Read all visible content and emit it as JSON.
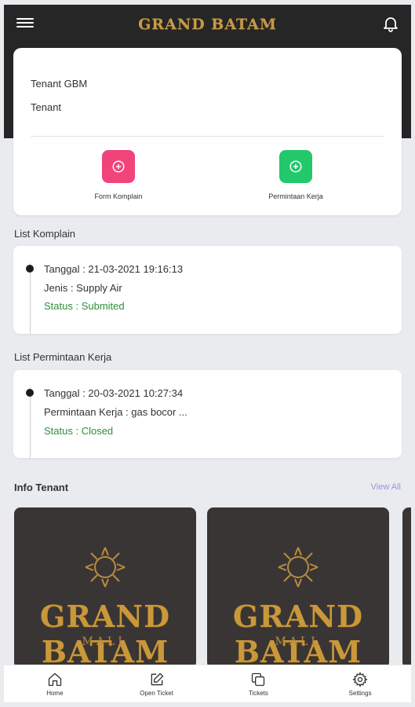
{
  "header": {
    "logo_text": "GRAND BATAM",
    "menu_icon": "hamburger-menu-icon",
    "bell_icon": "bell-icon"
  },
  "profile": {
    "tenant_name": "Tenant GBM",
    "role": "Tenant",
    "actions": [
      {
        "label": "Form Komplain",
        "icon": "plus-circle-icon",
        "color": "#f0447a"
      },
      {
        "label": "Permintaan Kerja",
        "icon": "plus-circle-icon",
        "color": "#22c86a"
      }
    ]
  },
  "komplain": {
    "section_title": "List Komplain",
    "item": {
      "tanggal": "Tanggal : 21-03-2021 19:16:13",
      "jenis": "Jenis : Supply Air",
      "status": "Status : Submited"
    }
  },
  "permintaan": {
    "section_title": "List Permintaan Kerja",
    "item": {
      "tanggal": "Tanggal : 20-03-2021 10:27:34",
      "detail": "Permintaan Kerja : gas bocor ...",
      "status": "Status : Closed"
    }
  },
  "info_tenant": {
    "section_title": "Info Tenant",
    "view_all": "View All",
    "cards": [
      {
        "brand": "GRAND BATAM",
        "sub": "MALL"
      },
      {
        "brand": "GRAND BATAM",
        "sub": "MALL"
      }
    ]
  },
  "bottom_nav": [
    {
      "label": "Home",
      "icon": "home-icon"
    },
    {
      "label": "Open Ticket",
      "icon": "edit-icon"
    },
    {
      "label": "Tickets",
      "icon": "copy-icon"
    },
    {
      "label": "Settings",
      "icon": "gear-icon"
    }
  ],
  "colors": {
    "header": "#262626",
    "gold": "#c79a46",
    "status_green": "#2f8f3a",
    "link": "#9a92e8"
  }
}
